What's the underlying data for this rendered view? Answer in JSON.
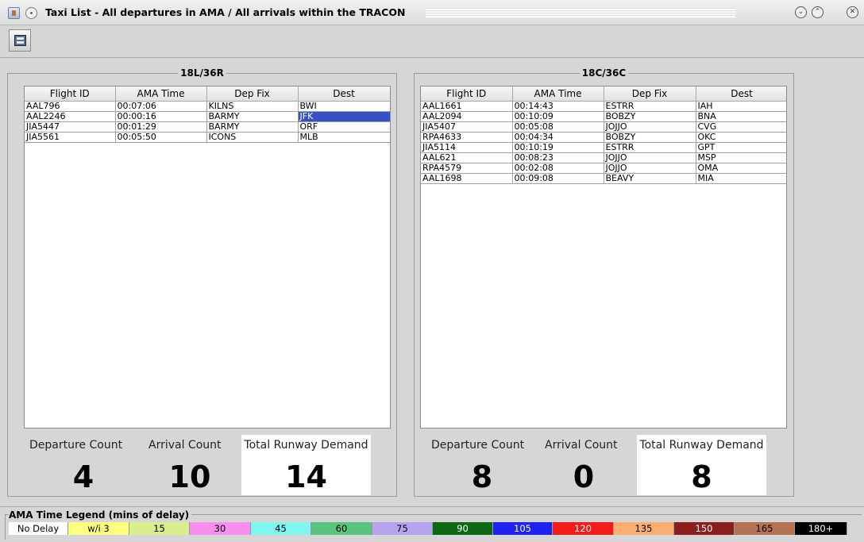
{
  "window": {
    "title": "Taxi List - All departures in AMA / All arrivals within the TRACON",
    "controls": [
      "minimize",
      "maximize",
      "close"
    ]
  },
  "toolbar": {
    "button_icon": "display-settings-icon"
  },
  "panels": [
    {
      "title": "18L/36R",
      "columns": [
        "Flight ID",
        "AMA Time",
        "Dep Fix",
        "Dest"
      ],
      "rows": [
        [
          "AAL796",
          "00:07:06",
          "KILNS",
          "BWI"
        ],
        [
          "AAL2246",
          "00:00:16",
          "BARMY",
          "JFK"
        ],
        [
          "JIA5447",
          "00:01:29",
          "BARMY",
          "ORF"
        ],
        [
          "JIA5561",
          "00:05:50",
          "ICONS",
          "MLB"
        ]
      ],
      "selected_cell": {
        "row": 1,
        "col": 3
      },
      "departure_label": "Departure Count",
      "departure_count": "4",
      "arrival_label": "Arrival Count",
      "arrival_count": "10",
      "total_label": "Total Runway Demand",
      "total_count": "14"
    },
    {
      "title": "18C/36C",
      "columns": [
        "Flight ID",
        "AMA Time",
        "Dep Fix",
        "Dest"
      ],
      "rows": [
        [
          "AAL1661",
          "00:14:43",
          "ESTRR",
          "IAH"
        ],
        [
          "AAL2094",
          "00:10:09",
          "BOBZY",
          "BNA"
        ],
        [
          "JIA5407",
          "00:05:08",
          "JOJJO",
          "CVG"
        ],
        [
          "RPA4633",
          "00:04:34",
          "BOBZY",
          "OKC"
        ],
        [
          "JIA5114",
          "00:10:19",
          "ESTRR",
          "GPT"
        ],
        [
          "AAL621",
          "00:08:23",
          "JOJJO",
          "MSP"
        ],
        [
          "RPA4579",
          "00:02:08",
          "JOJJO",
          "OMA"
        ],
        [
          "AAL1698",
          "00:09:08",
          "BEAVY",
          "MIA"
        ]
      ],
      "selected_cell": null,
      "departure_label": "Departure Count",
      "departure_count": "8",
      "arrival_label": "Arrival Count",
      "arrival_count": "0",
      "total_label": "Total Runway Demand",
      "total_count": "8"
    }
  ],
  "legend": {
    "title": "AMA Time Legend (mins of delay)",
    "items": [
      {
        "label": "No Delay",
        "bg": "#ffffff",
        "fg": "#000000"
      },
      {
        "label": "w/i 3",
        "bg": "#ffff80",
        "fg": "#000000"
      },
      {
        "label": "15",
        "bg": "#d7f08b",
        "fg": "#000000"
      },
      {
        "label": "30",
        "bg": "#f98ef0",
        "fg": "#000000"
      },
      {
        "label": "45",
        "bg": "#7ff7f0",
        "fg": "#000000"
      },
      {
        "label": "60",
        "bg": "#58c47d",
        "fg": "#000000"
      },
      {
        "label": "75",
        "bg": "#b7a3ef",
        "fg": "#000000"
      },
      {
        "label": "90",
        "bg": "#0d6a12",
        "fg": "#ffffff"
      },
      {
        "label": "105",
        "bg": "#1f22f0",
        "fg": "#ffffff"
      },
      {
        "label": "120",
        "bg": "#f41b1b",
        "fg": "#ffffff"
      },
      {
        "label": "135",
        "bg": "#fcae70",
        "fg": "#000000"
      },
      {
        "label": "150",
        "bg": "#8a1f1c",
        "fg": "#ffffff"
      },
      {
        "label": "165",
        "bg": "#b57255",
        "fg": "#000000"
      },
      {
        "label": "180+",
        "bg": "#000000",
        "fg": "#ffffff"
      }
    ]
  }
}
